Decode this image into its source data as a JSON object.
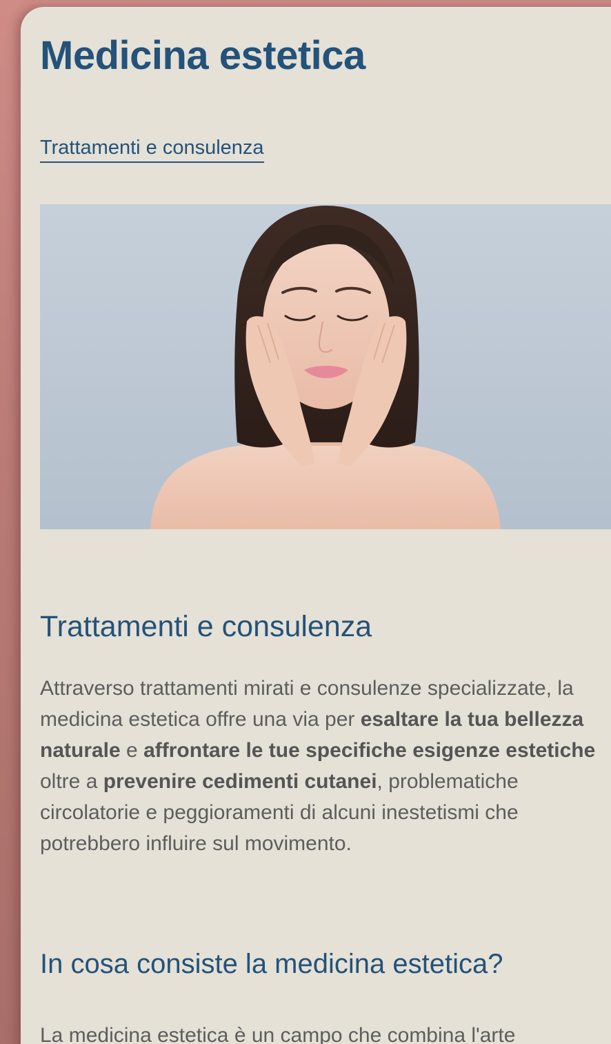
{
  "page": {
    "title": "Medicina estetica",
    "breadcrumb_link": "Trattamenti e consulenza"
  },
  "hero": {
    "alt": "Donna con gli occhi chiusi che si tocca il viso con le mani"
  },
  "section_treatments": {
    "heading": "Trattamenti e consulenza",
    "paragraph": {
      "t1": "Attraverso trattamenti mirati e consulenze specializzate, la medicina estetica offre una via per ",
      "b1": "esaltare la tua bellezza naturale",
      "t2": " e ",
      "b2": "affrontare le tue specifiche esigenze estetiche",
      "t3": " oltre a ",
      "b3": "prevenire cedimenti cutanei",
      "t4": ", problematiche circolatorie e peggioramenti di alcuni inestetismi che potrebbero influire sul movimento."
    }
  },
  "section_what": {
    "heading": "In cosa consiste la medicina estetica?",
    "paragraph": "La medicina estetica è un campo che combina l'arte"
  },
  "colors": {
    "page_background": "#cf8c86",
    "sheet_background": "#e5e1d6",
    "heading_blue": "#23527a",
    "body_text": "#5d5d5d",
    "hero_background": "#c6d0da"
  }
}
